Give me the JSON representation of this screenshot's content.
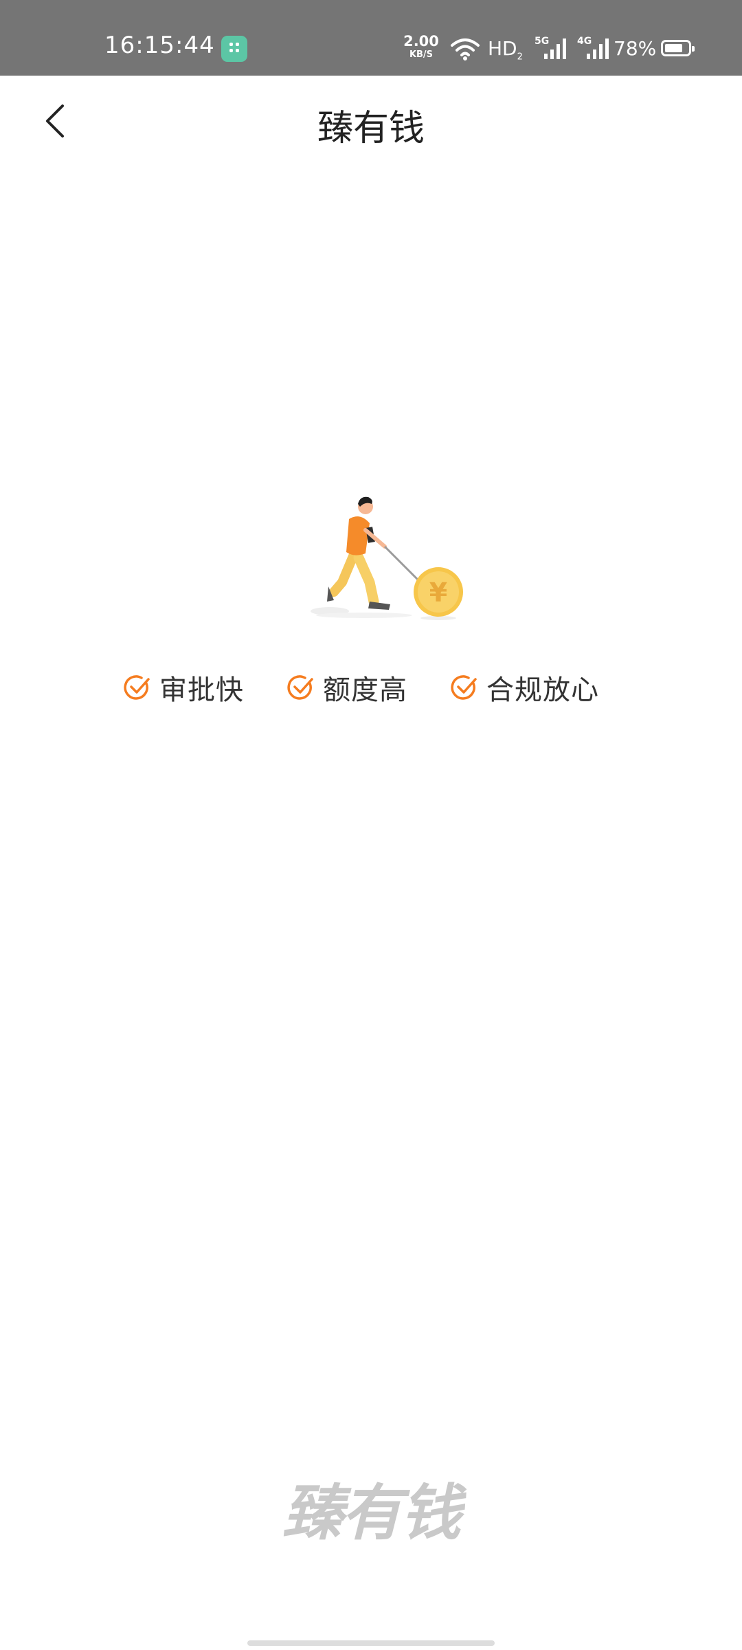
{
  "status_bar": {
    "time": "16:15:44",
    "net_speed_value": "2.00",
    "net_speed_unit": "KB/S",
    "hd_label": "HD",
    "hd_sub": "2",
    "sim1_gen": "5G",
    "sim2_gen": "4G",
    "battery_percent": "78%",
    "battery_level": 0.78
  },
  "header": {
    "title": "臻有钱",
    "back_icon": "chevron-left-icon"
  },
  "illustration": {
    "description_icon": "person-rolling-coin-icon",
    "coin_symbol": "¥"
  },
  "features": [
    {
      "label": "审批快",
      "icon": "check-circle-icon"
    },
    {
      "label": "额度高",
      "icon": "check-circle-icon"
    },
    {
      "label": "合规放心",
      "icon": "check-circle-icon"
    }
  ],
  "footer": {
    "logo_text": "臻有钱"
  },
  "colors": {
    "accent": "#f57c1f",
    "coin": "#f7c64a",
    "status_bar_bg": "#757575",
    "logo_gray": "#c9c9c9"
  }
}
